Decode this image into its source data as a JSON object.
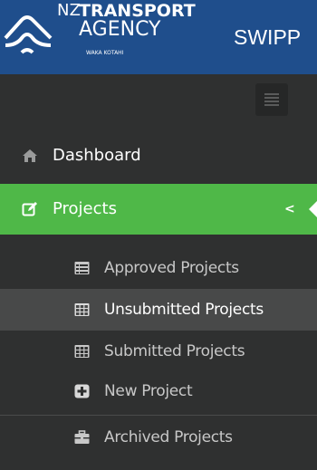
{
  "header": {
    "logo_nz": "NZ",
    "logo_transport": "TRANSPORT",
    "logo_agency": "AGENCY",
    "logo_maori": "WAKA KOTAHI",
    "app_title": "SWIPP"
  },
  "sidebar": {
    "toggle_icon": "hamburger-icon",
    "items": [
      {
        "label": "Dashboard",
        "icon": "home-icon"
      },
      {
        "label": "Projects",
        "icon": "edit-icon",
        "active": true,
        "chevron": "<"
      }
    ],
    "submenu": [
      {
        "label": "Approved Projects",
        "icon": "list-icon"
      },
      {
        "label": "Unsubmitted Projects",
        "icon": "table-icon",
        "active": true
      },
      {
        "label": "Submitted Projects",
        "icon": "table-icon"
      },
      {
        "label": "New Project",
        "icon": "plus-square-icon"
      },
      {
        "label": "Archived Projects",
        "icon": "archive-icon"
      }
    ]
  },
  "colors": {
    "header_bg": "#1f4e8c",
    "sidebar_bg": "#2f3030",
    "active_green": "#4fb848",
    "active_sub_bg": "#484949"
  }
}
